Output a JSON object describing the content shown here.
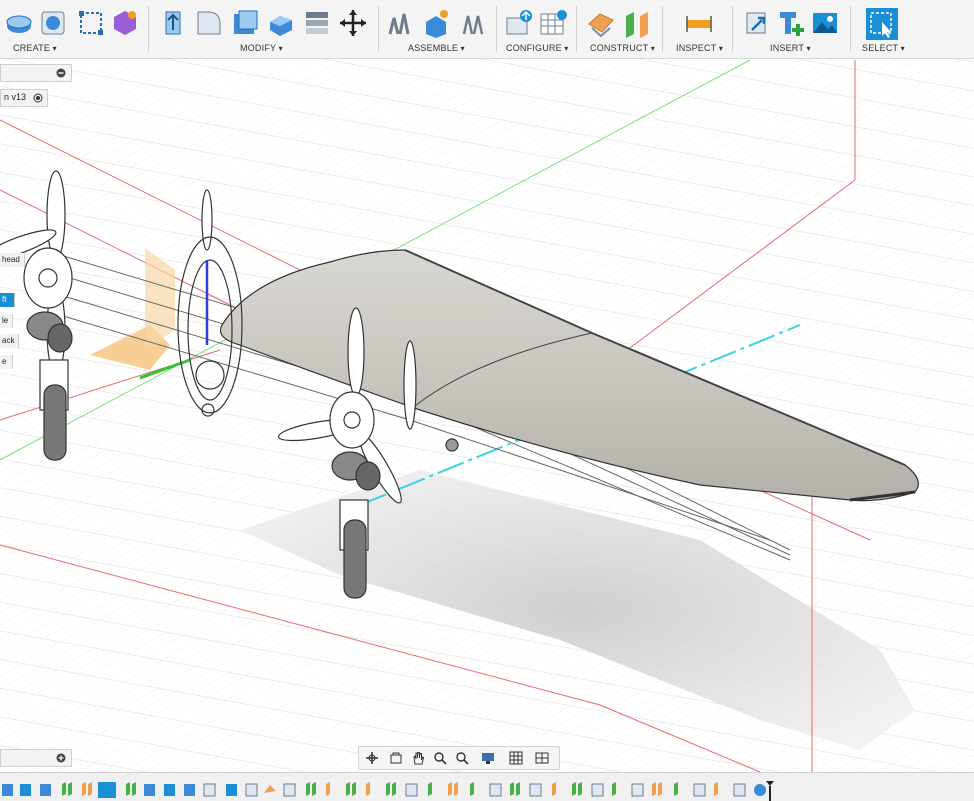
{
  "toolbar": {
    "groups": [
      {
        "label": "CREATE"
      },
      {
        "label": "MODIFY"
      },
      {
        "label": "ASSEMBLE"
      },
      {
        "label": "CONFIGURE"
      },
      {
        "label": "CONSTRUCT"
      },
      {
        "label": "INSPECT"
      },
      {
        "label": "INSERT"
      },
      {
        "label": "SELECT"
      }
    ]
  },
  "browser": {
    "component_label": "n v13",
    "items": [
      {
        "label": "head"
      },
      {
        "label": "ft"
      },
      {
        "label": "le"
      },
      {
        "label": "ack"
      },
      {
        "label": "e"
      }
    ]
  },
  "colors": {
    "accent": "#1a8fd6",
    "grid": "#e2e2e2",
    "axis_red": "#e46a6a",
    "axis_green": "#7de07d",
    "axis_blue": "#2b3fd6",
    "axis_cyan": "#36d4e4",
    "wing": "#c9c7c0",
    "sketch_plane": "#f3b35c"
  },
  "icons": {
    "create": [
      "extrude-icon",
      "revolve-icon",
      "sketch-icon",
      "form-icon"
    ],
    "modify": [
      "press-pull-icon",
      "fillet-icon",
      "shell-icon",
      "combine-icon",
      "scale-icon",
      "move-icon"
    ],
    "assemble": [
      "joint-icon",
      "as-built-joint-icon",
      "motion-link-icon"
    ],
    "configure": [
      "configure-icon",
      "table-icon"
    ],
    "construct": [
      "offset-plane-icon",
      "midplane-icon"
    ],
    "inspect": [
      "measure-icon"
    ],
    "insert": [
      "insert-link-icon",
      "insert-component-icon",
      "insert-image-icon"
    ],
    "select": [
      "select-box-icon"
    ],
    "nav": [
      "orbit-icon",
      "view-icon",
      "pan-icon",
      "zoom-fit-icon",
      "zoom-icon",
      "display-icon",
      "grid-icon",
      "viewports-icon"
    ]
  }
}
